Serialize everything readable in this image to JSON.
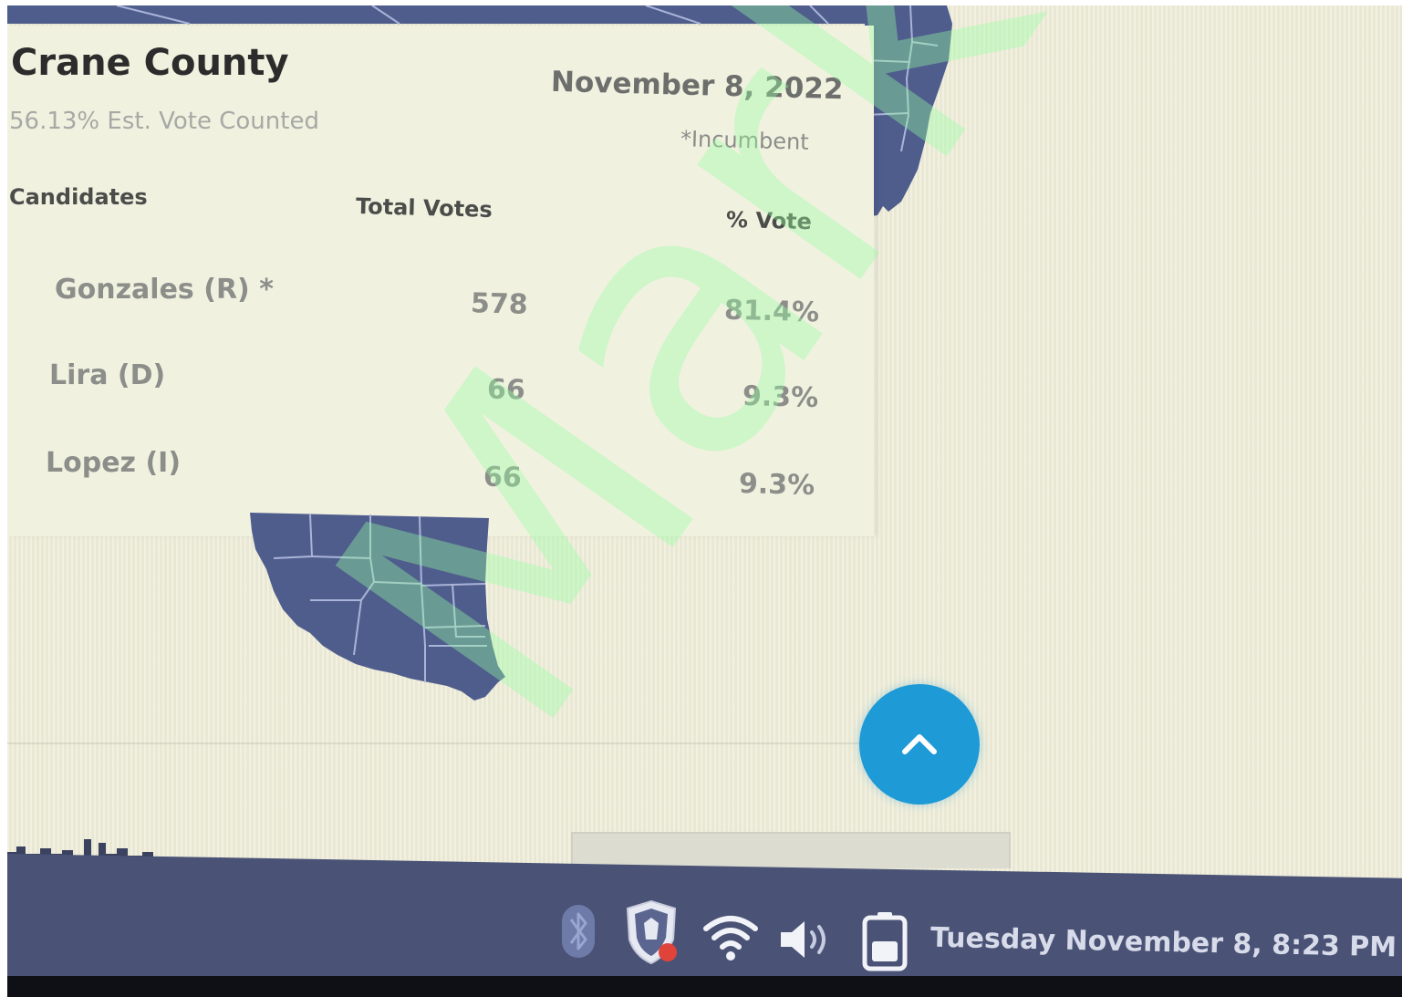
{
  "results_card": {
    "county_title": "Crane County",
    "vote_counted": "56.13% Est. Vote Counted",
    "date": "November 8, 2022",
    "incumbent_note": "*Incumbent",
    "columns": {
      "candidates": "Candidates",
      "total_votes": "Total Votes",
      "pct_vote": "% Vote"
    },
    "rows": [
      {
        "candidate": "Gonzales (R) *",
        "votes": "578",
        "pct": "81.4%"
      },
      {
        "candidate": "Lira (D)",
        "votes": "66",
        "pct": "9.3%"
      },
      {
        "candidate": "Lopez (I)",
        "votes": "66",
        "pct": "9.3%"
      }
    ]
  },
  "map": {
    "icon": "county-region-map",
    "fill_color": "#4f5d8d",
    "border_color": "#aab4d8"
  },
  "scroll_top_button": {
    "icon": "chevron-up-icon",
    "color": "#1e9ad6"
  },
  "taskbar": {
    "color": "#4a5376",
    "tray_icons": [
      "bluetooth-icon",
      "security-shield-icon",
      "wifi-icon",
      "volume-icon",
      "battery-icon"
    ],
    "clock": "Tuesday November 8, 8:23 PM"
  },
  "watermark": {
    "text": "Mark Co",
    "color": "#96ffa0"
  }
}
